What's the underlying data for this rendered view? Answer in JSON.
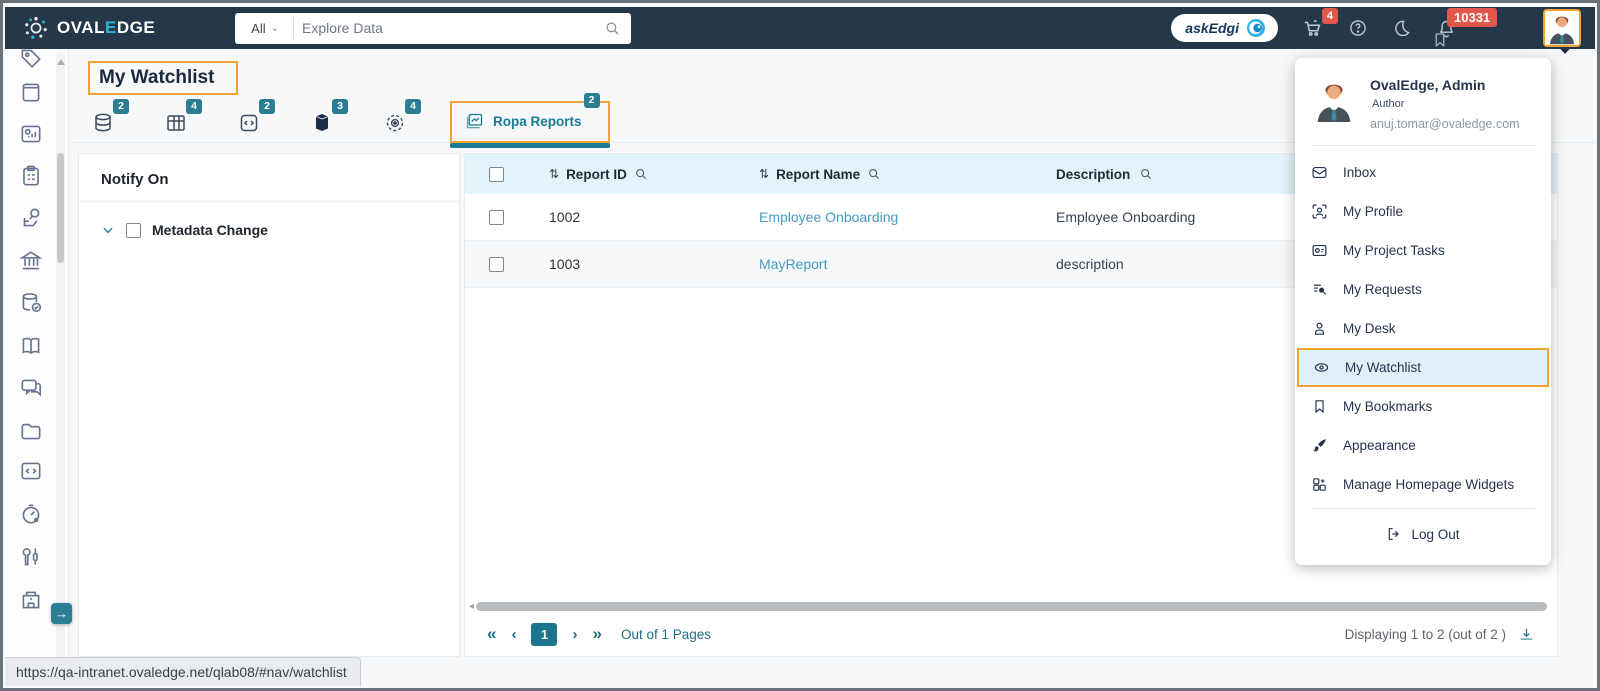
{
  "topbar": {
    "logo": {
      "part1": "OVAL",
      "part2": "E",
      "part3": "DGE"
    },
    "search": {
      "scope": "All",
      "placeholder": "Explore Data"
    },
    "askedgi": "askEdgi",
    "cart_badge": "4",
    "notif_badge": "10331"
  },
  "page": {
    "title": "My Watchlist"
  },
  "tabs": {
    "counts": [
      "2",
      "4",
      "2",
      "3",
      "4"
    ],
    "active": {
      "label": "Ropa Reports",
      "count": "2"
    }
  },
  "notify": {
    "title": "Notify On",
    "item": "Metadata Change"
  },
  "report_table": {
    "headers": [
      "Report ID",
      "Report Name",
      "Description"
    ],
    "rows": [
      {
        "id": "1002",
        "name": "Employee Onboarding",
        "description": "Employee Onboarding"
      },
      {
        "id": "1003",
        "name": "MayReport",
        "description": "description"
      }
    ]
  },
  "pagination": {
    "first": "«",
    "prev": "‹",
    "current": "1",
    "next": "›",
    "last": "»",
    "pages_label": "Out of 1 Pages",
    "displaying": "Displaying 1 to 2  (out of 2 )"
  },
  "user_menu": {
    "name": "OvalEdge, Admin",
    "role": "Author",
    "email": "anuj.tomar@ovaledge.com",
    "items": [
      {
        "label": "Inbox"
      },
      {
        "label": "My Profile"
      },
      {
        "label": "My Project Tasks"
      },
      {
        "label": "My Requests"
      },
      {
        "label": "My Desk"
      },
      {
        "label": "My Watchlist"
      },
      {
        "label": "My Bookmarks"
      },
      {
        "label": "Appearance"
      },
      {
        "label": "Manage Homepage Widgets"
      }
    ],
    "logout": "Log Out"
  },
  "statusbar": {
    "url": "https://qa-intranet.ovaledge.net/qlab08/#nav/watchlist"
  },
  "icons": {
    "sort_glyph": "⇅",
    "scroll_left_glyph": "◂",
    "expand_glyph": "→",
    "scope_chevron": "⌄"
  },
  "colors": {
    "navbar": "#24384a",
    "accent": "#1b7a94",
    "badge": "#2a7d93",
    "highlight": "#f0a330",
    "danger": "#e2574c",
    "link": "#459bc0",
    "header_bg": "#e3f3fa"
  }
}
